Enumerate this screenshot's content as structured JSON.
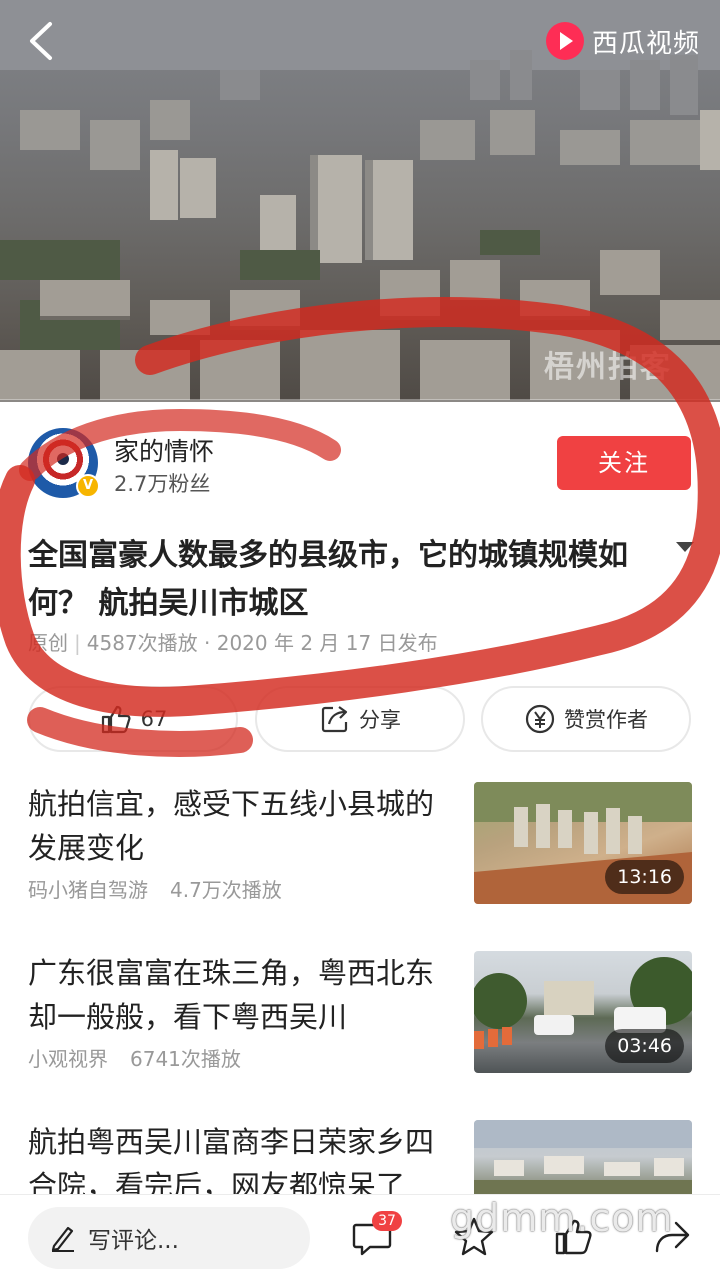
{
  "header": {
    "brand_name": "西瓜视频"
  },
  "video": {
    "watermark": "梧州拍客",
    "progress_percent": 0
  },
  "author": {
    "name": "家的情怀",
    "fans": "2.7万粉丝",
    "verified_badge": "V",
    "follow_label": "关注"
  },
  "post": {
    "title": "全国富豪人数最多的县级市，它的城镇规模如何？ 航拍吴川市城区",
    "meta_original": "原创",
    "meta_plays": "4587次播放",
    "meta_dot": "·",
    "meta_date": "2020 年 2 月 17 日发布"
  },
  "actions": {
    "like_count": "67",
    "share_label": "分享",
    "reward_label": "赞赏作者"
  },
  "recommendations": [
    {
      "title": "航拍信宜，感受下五线小县城的发展变化",
      "author": "码小猪自驾游",
      "plays": "4.7万次播放",
      "duration": "13:16"
    },
    {
      "title": "广东很富富在珠三角，粤西北东却一般般，看下粤西吴川",
      "author": "小观视界",
      "plays": "6741次播放",
      "duration": "03:46"
    },
    {
      "title": "航拍粤西吴川富商李日荣家乡四合院，看完后，网友都惊呆了",
      "author": "",
      "plays": "",
      "duration": ""
    }
  ],
  "bottom_bar": {
    "comment_placeholder": "写评论...",
    "comment_count": "37"
  },
  "site_watermark": "gdmm.com",
  "colors": {
    "accent": "#f04142",
    "brand": "#fe2d55",
    "marker": "#d32a1f"
  },
  "icons": [
    "back-icon",
    "play-logo-icon",
    "thumbs-up-icon",
    "share-icon",
    "yen-coin-icon",
    "pencil-icon",
    "comment-icon",
    "star-icon",
    "forward-icon"
  ]
}
